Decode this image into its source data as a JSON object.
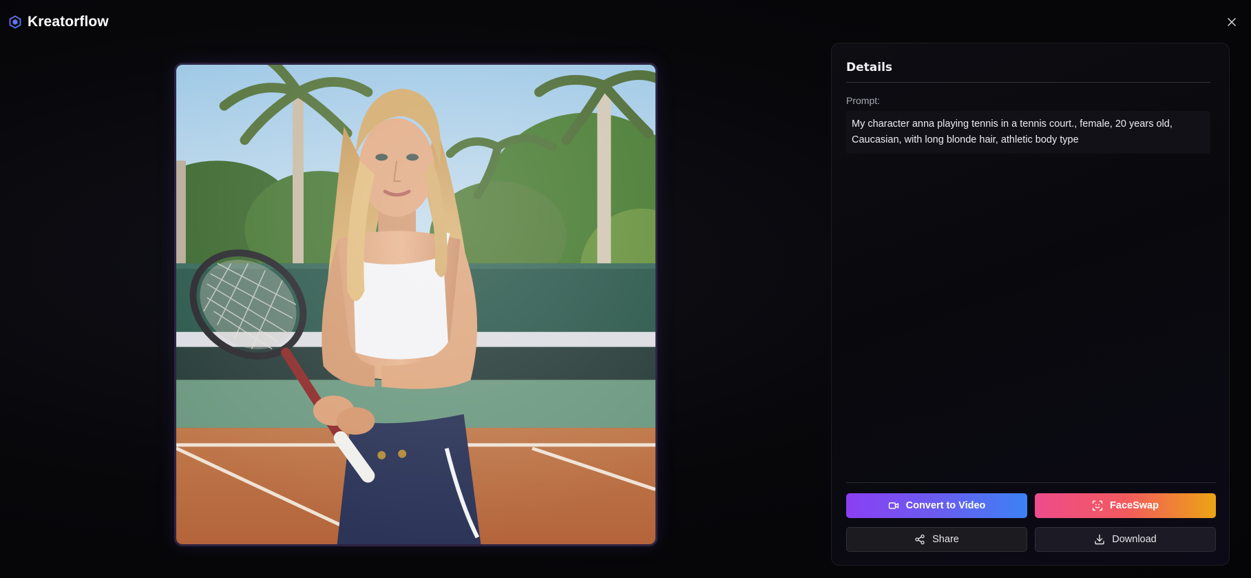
{
  "app": {
    "title": "Kreatorflow",
    "logo_icon": "hexagon-logo-icon"
  },
  "window": {
    "close_icon": "close-icon"
  },
  "image": {
    "subject": "generated-image"
  },
  "details": {
    "title": "Details",
    "prompt_label": "Prompt:",
    "prompt_text": "My character anna playing tennis in a tennis court., female, 20 years old, Caucasian, with long blonde hair, athletic body type"
  },
  "actions": {
    "convert_to_video": {
      "label": "Convert to Video",
      "icon": "video-camera-icon"
    },
    "faceswap": {
      "label": "FaceSwap",
      "icon": "face-scan-icon"
    },
    "share": {
      "label": "Share",
      "icon": "share-icon"
    },
    "download": {
      "label": "Download",
      "icon": "download-icon"
    }
  },
  "colors": {
    "background": "#060608",
    "panel_border": "#1c1c24",
    "video_gradient": [
      "#8b3ff2",
      "#3c82f4"
    ],
    "faceswap_gradient": [
      "#ee4b8c",
      "#eca414"
    ]
  }
}
